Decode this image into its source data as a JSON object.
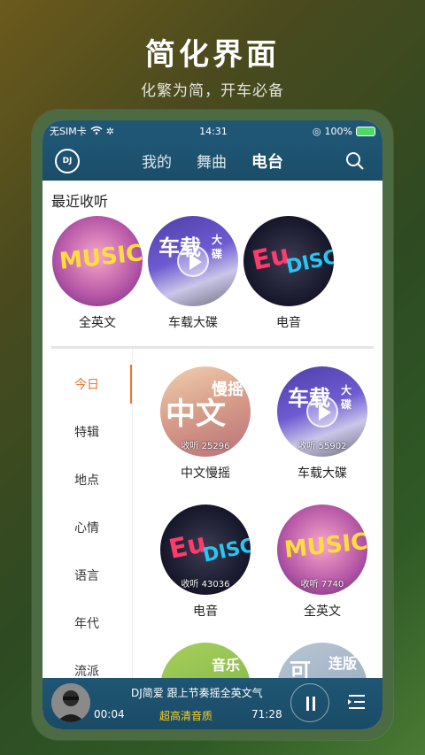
{
  "promo": {
    "title": "简化界面",
    "subtitle": "化繁为简，开车必备"
  },
  "status_bar": {
    "carrier": "无SIM卡",
    "time": "14:31",
    "battery": "100%"
  },
  "nav": {
    "logo": "DJ",
    "tabs": [
      "我的",
      "舞曲",
      "电台"
    ],
    "active_tab": "电台"
  },
  "recent": {
    "title": "最近收听",
    "items": [
      {
        "name": "全英文",
        "art": "music"
      },
      {
        "name": "车载大碟",
        "art": "car"
      },
      {
        "name": "电音",
        "art": "electro"
      }
    ]
  },
  "categories": [
    "今日",
    "特辑",
    "地点",
    "心情",
    "语言",
    "年代",
    "流派"
  ],
  "active_category": "今日",
  "grid": [
    {
      "name": "中文慢摇",
      "listens": "收听 25296"
    },
    {
      "name": "车载大碟",
      "listens": "收听 55902"
    },
    {
      "name": "电音",
      "listens": "收听 43036"
    },
    {
      "name": "全英文",
      "listens": "收听 7740"
    }
  ],
  "disc_text": {
    "car": [
      "车载",
      "大",
      "碟"
    ],
    "zh": [
      "中文",
      "慢摇"
    ],
    "partial_1": [
      "音乐"
    ],
    "partial_2": [
      "可",
      "连版"
    ]
  },
  "player": {
    "song": "DJ简爱 跟上节奏摇全英文气",
    "time_now": "00:04",
    "quality": "超高清音质",
    "time_total": "71:28"
  },
  "colors": {
    "accent": "#e8772c",
    "nav": "#1f5674",
    "quality": "#ffd11a"
  }
}
